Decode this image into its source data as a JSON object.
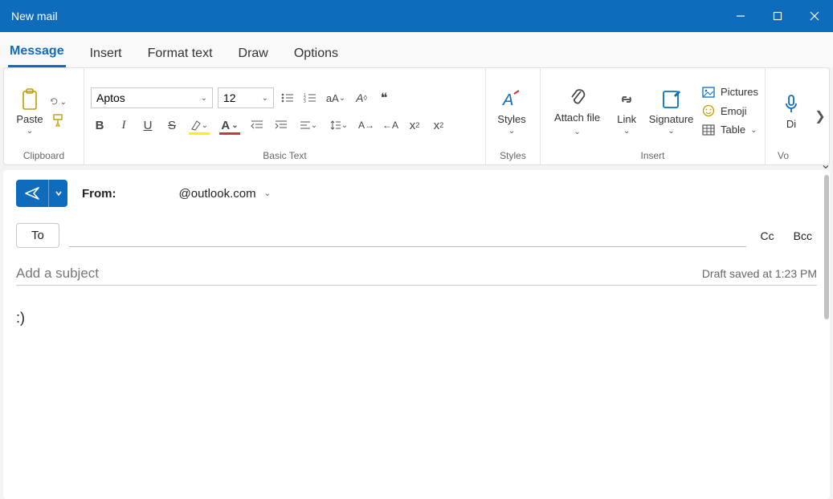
{
  "window": {
    "title": "New mail"
  },
  "tabs": [
    "Message",
    "Insert",
    "Format text",
    "Draw",
    "Options"
  ],
  "active_tab": 0,
  "ribbon": {
    "clipboard": {
      "paste": "Paste",
      "label": "Clipboard"
    },
    "basic_text": {
      "font": "Aptos",
      "size": "12",
      "label": "Basic Text"
    },
    "styles": {
      "btn": "Styles",
      "label": "Styles"
    },
    "insert": {
      "attach": "Attach file",
      "link": "Link",
      "signature": "Signature",
      "pictures": "Pictures",
      "emoji": "Emoji",
      "table": "Table",
      "label": "Insert"
    },
    "voice": {
      "btn": "Di",
      "label": "V"
    }
  },
  "compose": {
    "from_label": "From:",
    "from_address": "@outlook.com",
    "to_label": "To",
    "cc": "Cc",
    "bcc": "Bcc",
    "subject_placeholder": "Add a subject",
    "subject_value": "",
    "draft_status": "Draft saved at 1:23 PM",
    "body": ":)"
  }
}
